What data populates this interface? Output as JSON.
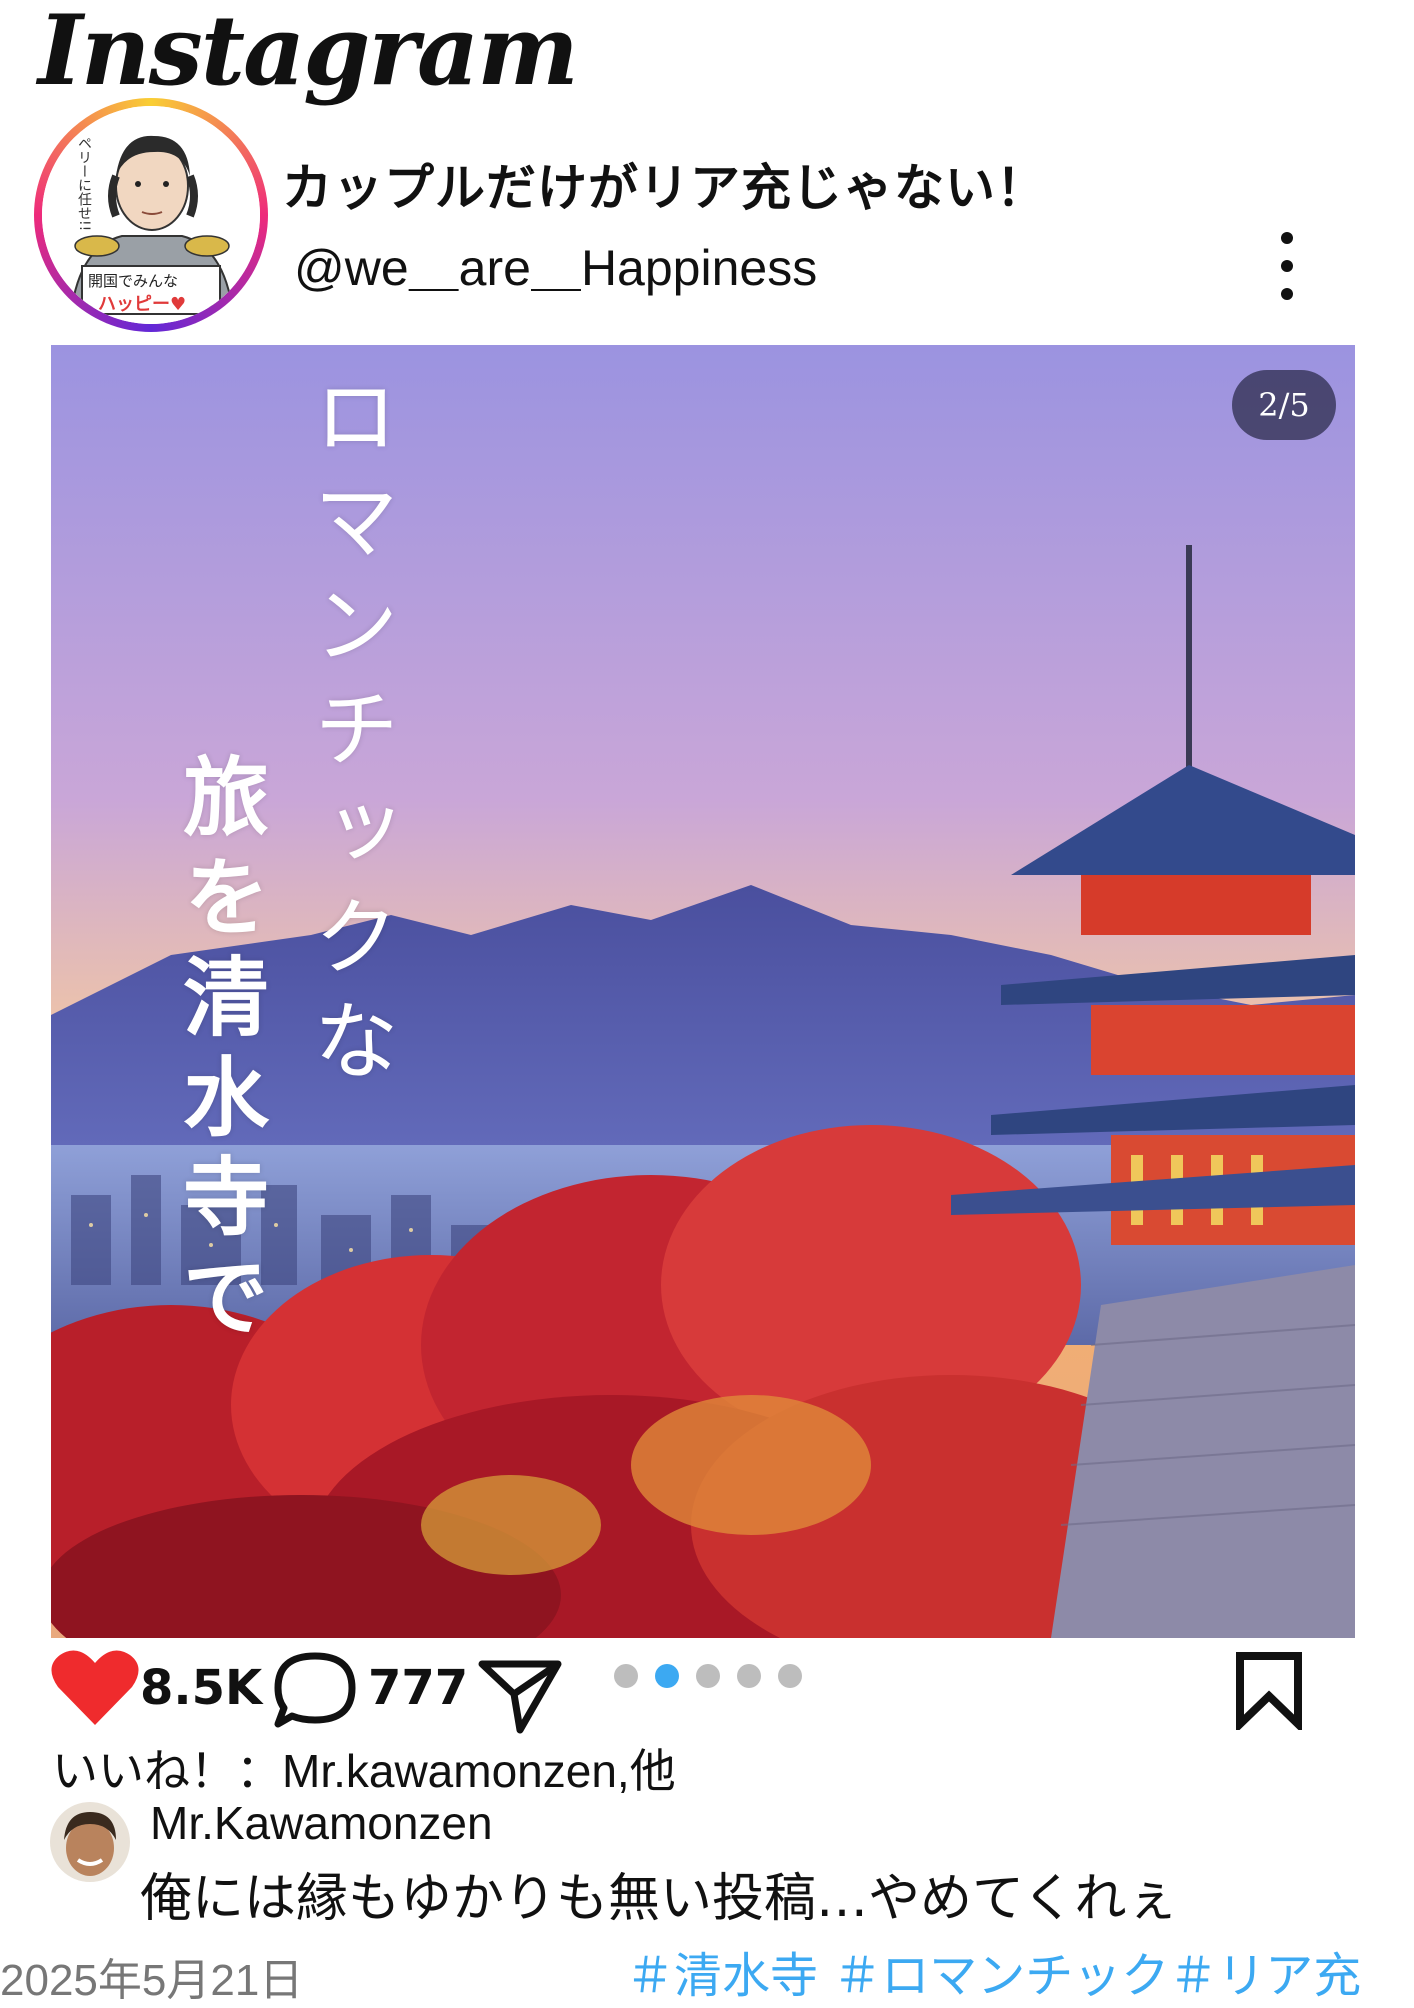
{
  "header": {
    "logo_text": "Instagram",
    "post_title": "カップルだけがリア充じゃない！",
    "handle": "@we＿are＿Happiness",
    "menu_icon": "more-vertical-icon",
    "avatar": {
      "badge_line1": "開国でみんな",
      "badge_line2": "ハッピー♥",
      "speech": "ペリーに任せ!!"
    }
  },
  "image": {
    "counter": "2/5",
    "overlay_line_right": "ロマンチックな",
    "overlay_line_left": "旅を清水寺で"
  },
  "actions": {
    "like_icon": "heart-icon",
    "like_count": "8.5K",
    "comment_icon": "comment-icon",
    "comment_count": "777",
    "share_icon": "send-icon",
    "bookmark_icon": "bookmark-icon",
    "carousel": {
      "total": 5,
      "active_index": 1,
      "active_color": "#3ca9f2",
      "inactive_color": "#bdbdbd"
    }
  },
  "liked_by": "いいね！：Mr.kawamonzen,他",
  "comment": {
    "author": "Mr.Kawamonzen",
    "text": "俺には縁もゆかりも無い投稿…やめてくれぇ"
  },
  "date": "2025年5月21日",
  "hashtags": "＃清水寺 ＃ロマンチック＃リア充",
  "colors": {
    "like": "#ef2b2d",
    "hashtag": "#3ca9f2"
  }
}
